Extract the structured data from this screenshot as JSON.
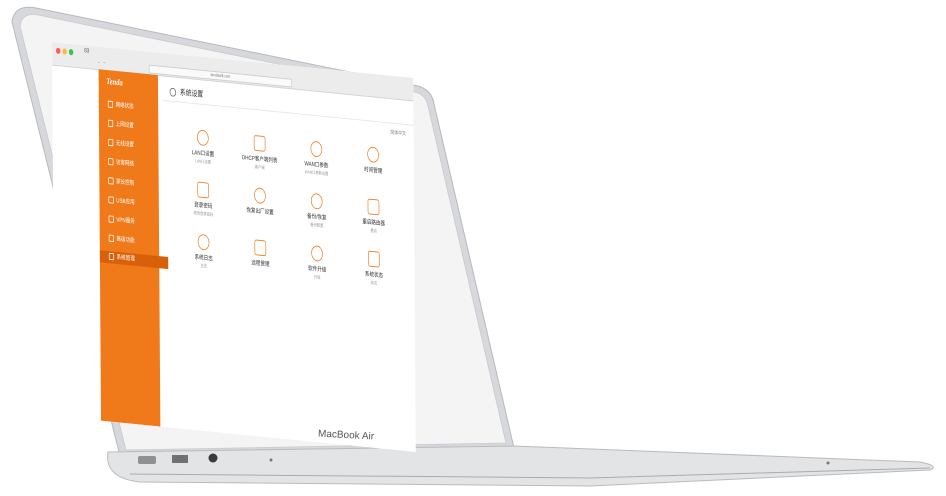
{
  "laptop": {
    "brand_label": "MacBook Air"
  },
  "browser": {
    "tab_title": "83",
    "address": "tendawifi.com",
    "nav_left": "← →"
  },
  "sidebar": {
    "logo": "Tenda",
    "items": [
      {
        "label": "网络状态"
      },
      {
        "label": "上网设置"
      },
      {
        "label": "无线设置"
      },
      {
        "label": "访客网络"
      },
      {
        "label": "家长控制"
      },
      {
        "label": "USB应用"
      },
      {
        "label": "VPN服务"
      },
      {
        "label": "高级功能"
      },
      {
        "label": "系统管理"
      }
    ]
  },
  "content": {
    "title": "系统设置",
    "lang": "简体中文",
    "tiles": [
      {
        "name": "LAN口设置",
        "sub": "LAN口设置"
      },
      {
        "name": "DHCP客户端列表",
        "sub": "客户端"
      },
      {
        "name": "WAN口参数",
        "sub": "WAN口参数设置"
      },
      {
        "name": "时间管理",
        "sub": ""
      },
      {
        "name": "登录密码",
        "sub": "修改登录密码"
      },
      {
        "name": "恢复出厂设置",
        "sub": ""
      },
      {
        "name": "备份/恢复",
        "sub": "备份配置"
      },
      {
        "name": "重启路由器",
        "sub": "重启"
      },
      {
        "name": "系统日志",
        "sub": "日志"
      },
      {
        "name": "远程管理",
        "sub": ""
      },
      {
        "name": "软件升级",
        "sub": "升级"
      },
      {
        "name": "系统状态",
        "sub": "状态"
      }
    ]
  }
}
